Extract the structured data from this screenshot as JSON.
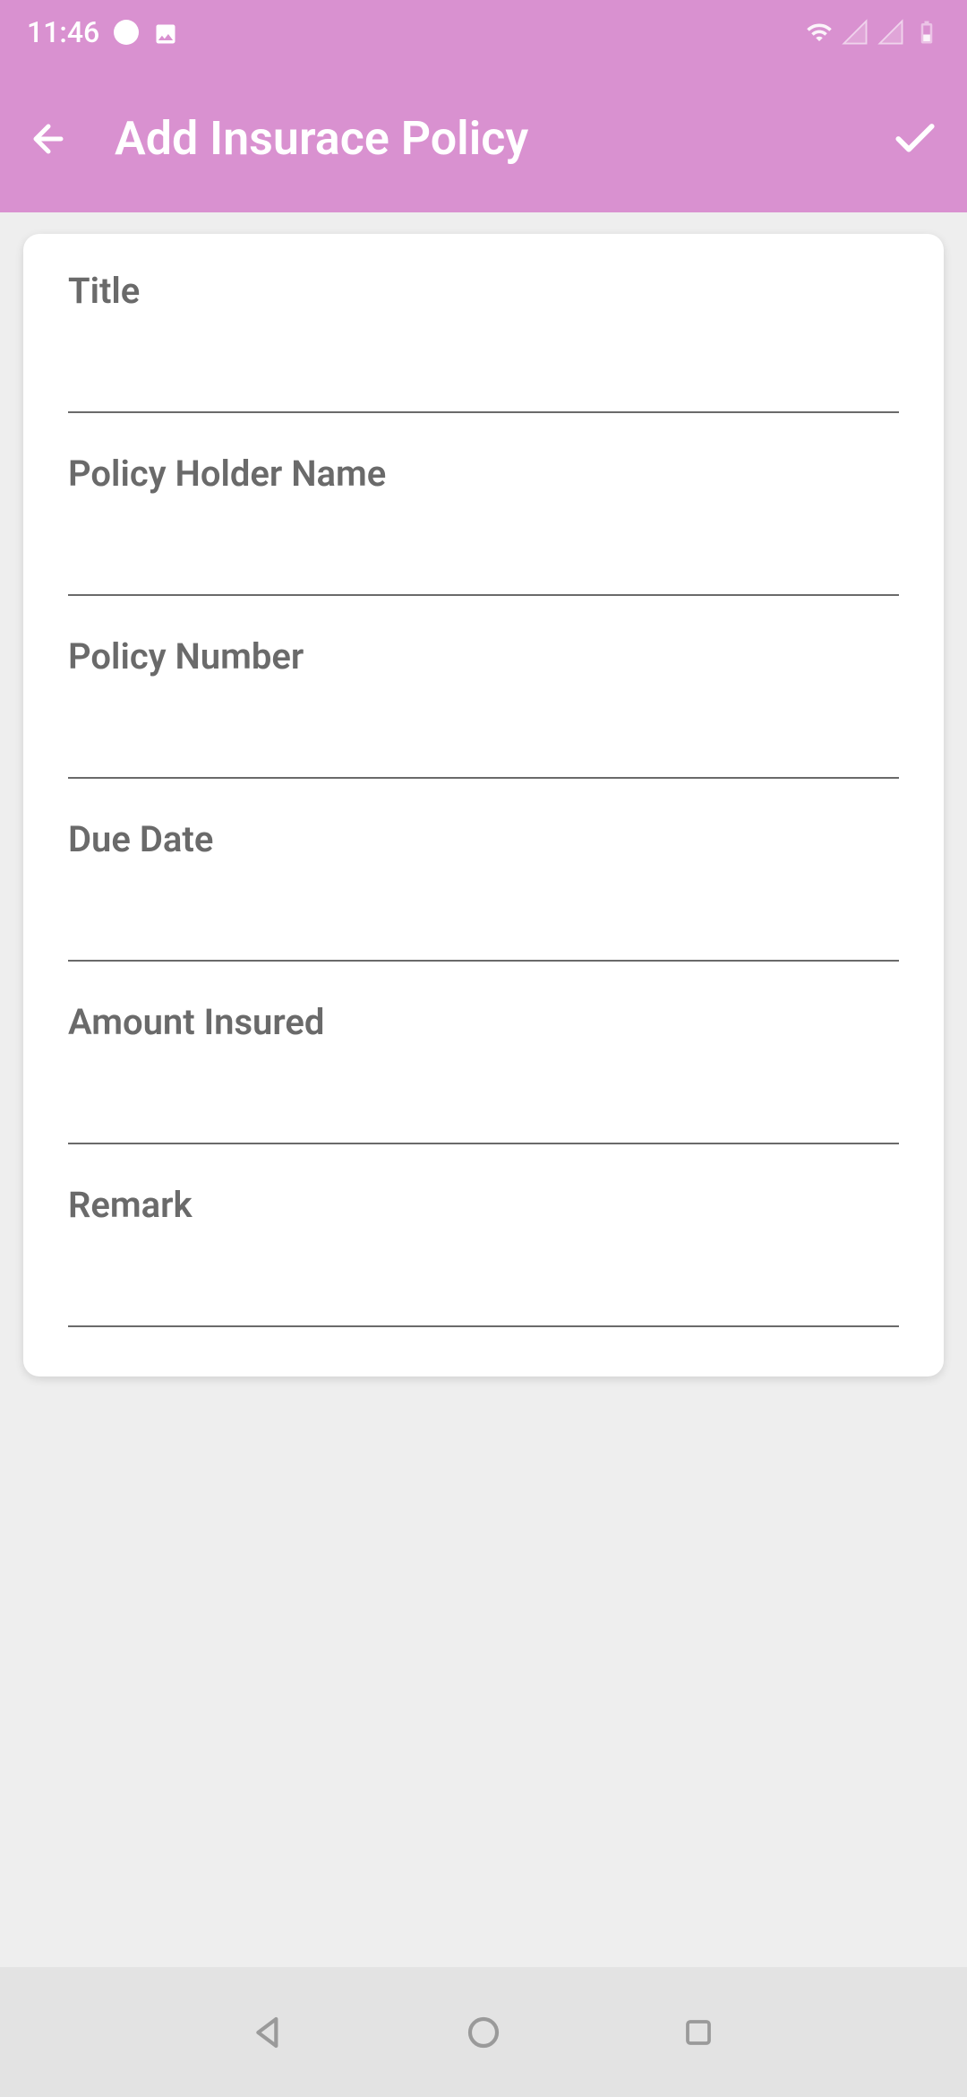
{
  "statusBar": {
    "time": "11:46"
  },
  "appBar": {
    "title": "Add Insurace Policy"
  },
  "form": {
    "fields": [
      {
        "label": "Title",
        "value": ""
      },
      {
        "label": "Policy Holder Name",
        "value": ""
      },
      {
        "label": "Policy Number",
        "value": ""
      },
      {
        "label": "Due Date",
        "value": ""
      },
      {
        "label": "Amount Insured",
        "value": ""
      },
      {
        "label": "Remark",
        "value": ""
      }
    ]
  }
}
